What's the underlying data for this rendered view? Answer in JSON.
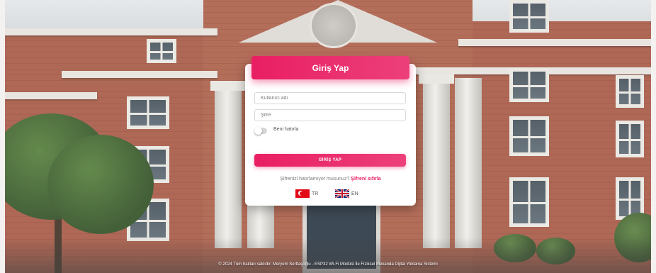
{
  "login": {
    "title": "Giriş Yap",
    "username_placeholder": "Kullanıcı adı",
    "password_placeholder": "Şifre",
    "remember_label": "Beni hatırla",
    "submit_label": "GİRİŞ YAP",
    "forgot_text": "Şifrenizi hatırlamıyor musunuz?",
    "reset_link": "Şifreni sıfırla"
  },
  "languages": [
    {
      "code": "TR",
      "flag": "turkey-flag-icon"
    },
    {
      "code": "EN",
      "flag": "uk-flag-icon"
    }
  ],
  "footer": {
    "text": "© 2024 Tüm hakları saklıdır. Meryem Serttaşoğlu - ESP32 Wi-Fi Modülü İle Fiziksel Mekanda Dijital Yoklama Sistemi"
  },
  "colors": {
    "accent": "#e91e63",
    "accent_light": "#ec407a",
    "card": "#ffffff"
  }
}
